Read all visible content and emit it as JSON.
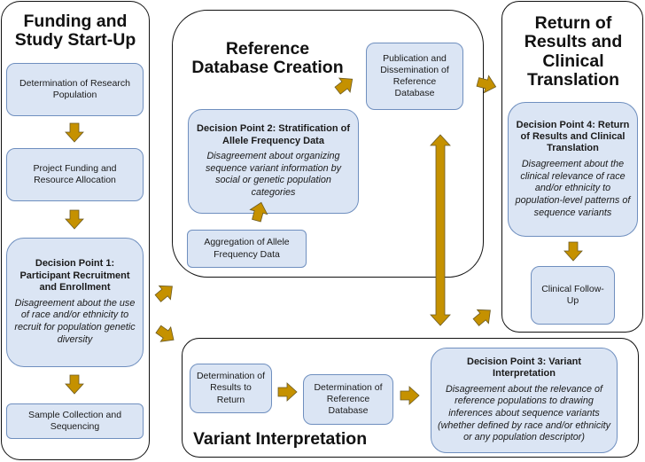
{
  "colors": {
    "box_fill": "#dbe5f4",
    "box_border": "#6f8fbf",
    "arrow": "#c59100",
    "container_border": "#111111"
  },
  "sections": {
    "funding": {
      "title": "Funding and Study Start-Up",
      "steps": [
        {
          "label": "Determination of Research Population"
        },
        {
          "label": "Project Funding and Resource Allocation"
        },
        {
          "title": "Decision Point 1: Participant Recruitment and Enrollment",
          "description": "Disagreement about the use of race and/or ethnicity to recruit for population genetic diversity"
        },
        {
          "label": "Sample Collection and Sequencing"
        }
      ]
    },
    "reference_db": {
      "title": "Reference Database Creation",
      "steps": [
        {
          "label": "Aggregation of Allele Frequency Data"
        },
        {
          "title": "Decision Point 2: Stratification of Allele Frequency Data",
          "description": "Disagreement about organizing sequence variant information by social or genetic population categories"
        },
        {
          "label": "Publication and Dissemination of Reference Database"
        }
      ]
    },
    "variant": {
      "title": "Variant Interpretation",
      "steps": [
        {
          "label": "Determination of Results to Return"
        },
        {
          "label": "Determination of Reference Database"
        },
        {
          "title": "Decision Point 3: Variant Interpretation",
          "description": "Disagreement about the relevance of reference populations to drawing inferences about sequence variants (whether defined by race and/or ethnicity or any population descriptor)"
        }
      ]
    },
    "return": {
      "title": "Return of Results and Clinical Translation",
      "steps": [
        {
          "title": "Decision Point 4: Return of Results and Clinical Translation",
          "description": "Disagreement about the clinical relevance of race and/or ethnicity to population-level patterns of sequence variants"
        },
        {
          "label": "Clinical Follow-Up"
        }
      ]
    }
  },
  "flows": [
    {
      "from": "Determination of Research Population",
      "to": "Project Funding and Resource Allocation"
    },
    {
      "from": "Project Funding and Resource Allocation",
      "to": "Decision Point 1"
    },
    {
      "from": "Decision Point 1",
      "to": "Sample Collection and Sequencing"
    },
    {
      "from": "Funding and Study Start-Up",
      "to": "Reference Database Creation"
    },
    {
      "from": "Funding and Study Start-Up",
      "to": "Variant Interpretation"
    },
    {
      "from": "Aggregation of Allele Frequency Data",
      "to": "Decision Point 2"
    },
    {
      "from": "Decision Point 2",
      "to": "Publication and Dissemination of Reference Database"
    },
    {
      "from": "Publication and Dissemination of Reference Database",
      "to": "Return of Results and Clinical Translation"
    },
    {
      "from": "Reference Database Creation",
      "to": "Variant Interpretation",
      "bidirectional": true
    },
    {
      "from": "Determination of Results to Return",
      "to": "Determination of Reference Database"
    },
    {
      "from": "Determination of Reference Database",
      "to": "Decision Point 3"
    },
    {
      "from": "Variant Interpretation",
      "to": "Return of Results and Clinical Translation"
    },
    {
      "from": "Decision Point 4",
      "to": "Clinical Follow-Up"
    }
  ]
}
